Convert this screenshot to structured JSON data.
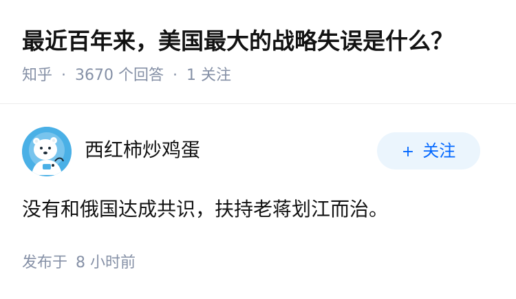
{
  "question": {
    "title": "最近百年来，美国最大的战略失误是什么？",
    "source": "知乎",
    "separator": "·",
    "answer_count": "3670",
    "answer_count_label": "个回答",
    "follow_count": "1",
    "follow_count_label": "关注"
  },
  "answer": {
    "author_name": "西红柿炒鸡蛋",
    "avatar_icon": "polar-bear-astronaut-avatar",
    "follow_button": {
      "plus": "+",
      "label": "关注"
    },
    "content": "没有和俄国达成共识，扶持老蒋划江而治。",
    "published_label": "发布于",
    "published_time": "8 小时前"
  },
  "colors": {
    "title": "#121212",
    "meta": "#8590a6",
    "accent": "#0066ff",
    "follow_button_bg": "#ebf5fd",
    "avatar_bg": "#4ab0e6",
    "divider": "#ebebeb"
  }
}
